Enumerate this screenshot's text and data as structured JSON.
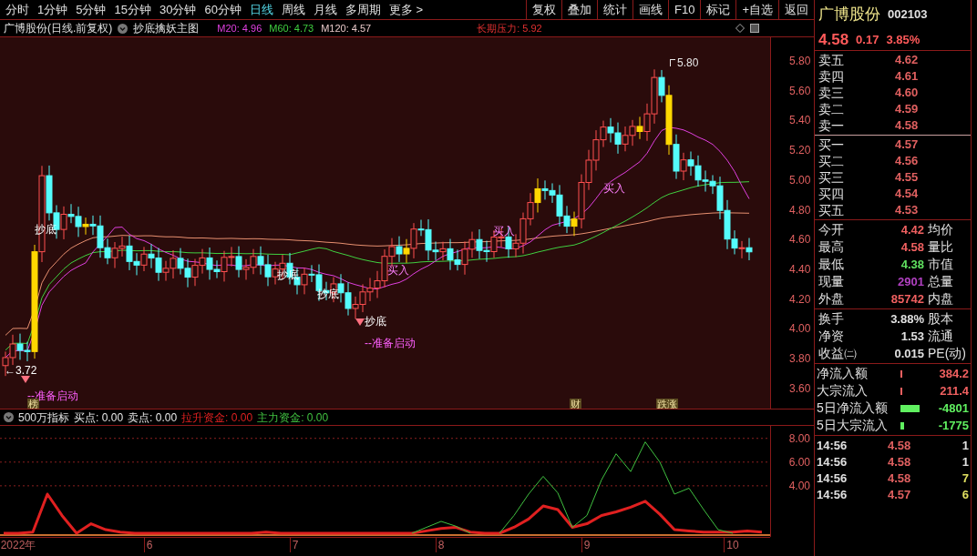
{
  "period_tabs": [
    {
      "label": "分时",
      "selected": false
    },
    {
      "label": "1分钟",
      "selected": false
    },
    {
      "label": "5分钟",
      "selected": false
    },
    {
      "label": "15分钟",
      "selected": false
    },
    {
      "label": "30分钟",
      "selected": false
    },
    {
      "label": "60分钟",
      "selected": false
    },
    {
      "label": "日线",
      "selected": true
    },
    {
      "label": "周线",
      "selected": false
    },
    {
      "label": "月线",
      "selected": false
    },
    {
      "label": "多周期",
      "selected": false
    },
    {
      "label": "更多 >",
      "selected": false
    }
  ],
  "tool_buttons": [
    "复权",
    "叠加",
    "统计",
    "画线",
    "F10",
    "标记",
    "+自选",
    "返回"
  ],
  "chart_header": {
    "title": "广博股份(日线.前复权)",
    "formula": "抄底擒妖主图",
    "averages": [
      {
        "label": "M20: 4.96",
        "color": "#e040e0"
      },
      {
        "label": "M60: 4.73",
        "color": "#40d040"
      },
      {
        "label": "M120: 4.57",
        "color": "#e8c8c8"
      }
    ],
    "pressure": "长期压力: 5.92"
  },
  "main_chart": {
    "y_ticks": [
      "5.80",
      "5.60",
      "5.40",
      "5.20",
      "5.00",
      "4.80",
      "4.60",
      "4.40",
      "4.20",
      "4.00",
      "3.80",
      "3.60"
    ],
    "annotations": [
      {
        "kind": "bottom",
        "text": "抄底"
      },
      {
        "kind": "bottom",
        "text": "抄底"
      },
      {
        "kind": "bottom",
        "text": "抄底"
      },
      {
        "kind": "bottom",
        "text": "抄底"
      },
      {
        "kind": "launch",
        "text": "--准备启动"
      },
      {
        "kind": "launch",
        "text": "--准备启动"
      },
      {
        "kind": "price",
        "text": "←3.72"
      },
      {
        "kind": "peak",
        "text": "5.80"
      },
      {
        "kind": "buy",
        "text": "买入"
      },
      {
        "kind": "buy",
        "text": "买入"
      },
      {
        "kind": "buy",
        "text": "买入"
      }
    ],
    "event_markers": [
      "榜",
      "财",
      "跌涨"
    ]
  },
  "indicator": {
    "name": "500万指标",
    "fields": [
      {
        "label": "买点: 0.00"
      },
      {
        "label": "卖点: 0.00"
      }
    ],
    "series_readings": [
      "0.00",
      "0.00"
    ],
    "chart_data": {
      "type": "line",
      "grid": true,
      "categories": [
        null,
        "2022年",
        null,
        null,
        null,
        null,
        null,
        null,
        null,
        null,
        "6",
        null,
        null,
        null,
        null,
        null,
        null,
        null,
        null,
        null,
        "7",
        null,
        null,
        null,
        null,
        null,
        null,
        null,
        null,
        null,
        "8",
        null,
        null,
        null,
        null,
        null,
        null,
        null,
        null,
        null,
        "9",
        null,
        null,
        null,
        null,
        null,
        null,
        null,
        null,
        null,
        "10",
        null,
        null
      ],
      "ylim": [
        0,
        8.9
      ],
      "yticks": [
        {
          "value": 4,
          "label": "4.00"
        },
        {
          "value": 6,
          "label": "6.00"
        },
        {
          "value": 8,
          "label": "8.00"
        }
      ],
      "series": [
        {
          "name": "拉升资金:",
          "color": "#e02020",
          "values": [
            0,
            0,
            0.1,
            3.3,
            1.5,
            0,
            0.8,
            0.3,
            0.1,
            0,
            0,
            0,
            0,
            0,
            0,
            0,
            0,
            0,
            0.1,
            0,
            0,
            0,
            0,
            0,
            0,
            0,
            0,
            0,
            0,
            0.2,
            0.4,
            0.5,
            0.1,
            0,
            0,
            0.5,
            1.2,
            2.3,
            2.0,
            0.5,
            0.8,
            1.5,
            1.8,
            2.2,
            2.7,
            1.6,
            0.3,
            0.2,
            0.1,
            0.1,
            0.1,
            0.2,
            0.1
          ]
        },
        {
          "name": "主力资金:",
          "color": "#40c040",
          "values": [
            null,
            null,
            null,
            null,
            null,
            null,
            null,
            null,
            null,
            null,
            null,
            null,
            null,
            null,
            null,
            null,
            null,
            null,
            null,
            null,
            null,
            null,
            null,
            null,
            null,
            null,
            null,
            null,
            0,
            0.5,
            1.0,
            0.6,
            0,
            null,
            0,
            1.5,
            3.3,
            4.8,
            3.4,
            0.5,
            1.5,
            4.5,
            6.7,
            5.2,
            7.7,
            6.0,
            3.3,
            3.8,
            2.0,
            0.3,
            0,
            null,
            null
          ]
        }
      ]
    }
  },
  "quote": {
    "name": "广博股份",
    "code": "002103",
    "price": "4.58",
    "change": "0.17",
    "percent": "3.85%",
    "sells": [
      {
        "label": "卖五",
        "price": "4.62"
      },
      {
        "label": "卖四",
        "price": "4.61"
      },
      {
        "label": "卖三",
        "price": "4.60"
      },
      {
        "label": "卖二",
        "price": "4.59"
      },
      {
        "label": "卖一",
        "price": "4.58"
      }
    ],
    "buys": [
      {
        "label": "买一",
        "price": "4.57"
      },
      {
        "label": "买二",
        "price": "4.56"
      },
      {
        "label": "买三",
        "price": "4.55"
      },
      {
        "label": "买四",
        "price": "4.54"
      },
      {
        "label": "买五",
        "price": "4.53"
      }
    ],
    "stats": [
      {
        "label": "今开",
        "value": "4.42",
        "color": "#f06060",
        "right": "均价"
      },
      {
        "label": "最高",
        "value": "4.58",
        "color": "#f06060",
        "right": "量比"
      },
      {
        "label": "最低",
        "value": "4.38",
        "color": "#60e060",
        "right": "市值"
      },
      {
        "label": "现量",
        "value": "2901",
        "color": "#b040c0",
        "right": "总量"
      },
      {
        "label": "外盘",
        "value": "85742",
        "color": "#f06060",
        "right": "内盘"
      }
    ],
    "finance": [
      {
        "label": "换手",
        "value": "3.88%",
        "right": "股本"
      },
      {
        "label": "净资",
        "value": "1.53",
        "right": "流通"
      },
      {
        "label": "收益㈡",
        "value": "0.015",
        "right": "PE(动)"
      }
    ],
    "flows": [
      {
        "label": "净流入额",
        "value": "384.2",
        "color": "#f06060"
      },
      {
        "label": "大宗流入",
        "value": "211.4",
        "color": "#f06060"
      },
      {
        "label": "5日净流入额",
        "value": "-4801",
        "color": "#60f060"
      },
      {
        "label": "5日大宗流入",
        "value": "-1775",
        "color": "#60f060"
      }
    ],
    "trades": [
      {
        "time": "14:56",
        "price": "4.58",
        "volume": "1",
        "kind": "sell"
      },
      {
        "time": "14:56",
        "price": "4.58",
        "volume": "1",
        "kind": "sell"
      },
      {
        "time": "14:56",
        "price": "4.58",
        "volume": "7",
        "kind": "buy"
      },
      {
        "time": "14:56",
        "price": "4.57",
        "volume": "6",
        "kind": "buy"
      }
    ]
  }
}
